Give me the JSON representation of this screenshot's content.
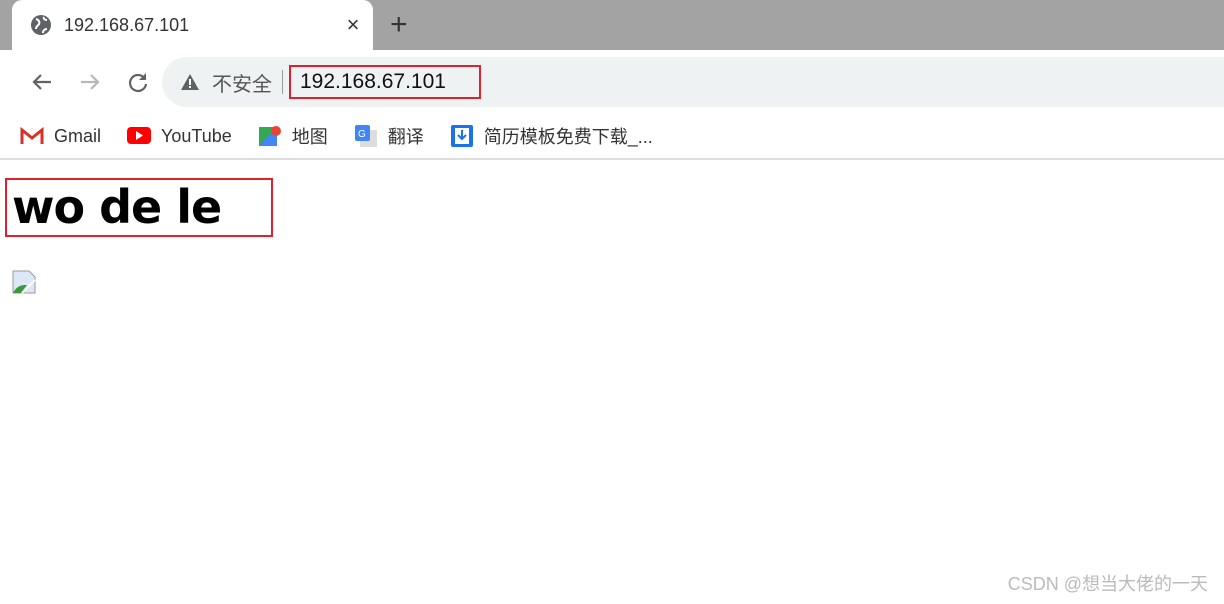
{
  "tab": {
    "title": "192.168.67.101",
    "close": "×",
    "new_tab": "+",
    "icon": "globe-icon"
  },
  "toolbar": {
    "security_label": "不安全",
    "url": "192.168.67.101"
  },
  "bookmarks": [
    {
      "label": "Gmail",
      "icon": "gmail-icon"
    },
    {
      "label": "YouTube",
      "icon": "youtube-icon"
    },
    {
      "label": "地图",
      "icon": "maps-icon"
    },
    {
      "label": "翻译",
      "icon": "translate-icon"
    },
    {
      "label": "简历模板免费下载_...",
      "icon": "bookmark-download-icon"
    }
  ],
  "page": {
    "heading": "wo de le",
    "image": "broken-image-icon"
  },
  "watermark": "CSDN @想当大佬的一天",
  "colors": {
    "highlight": "#e0202a",
    "tabbar": "#a3a3a3",
    "omnibox": "#eff2f3"
  }
}
